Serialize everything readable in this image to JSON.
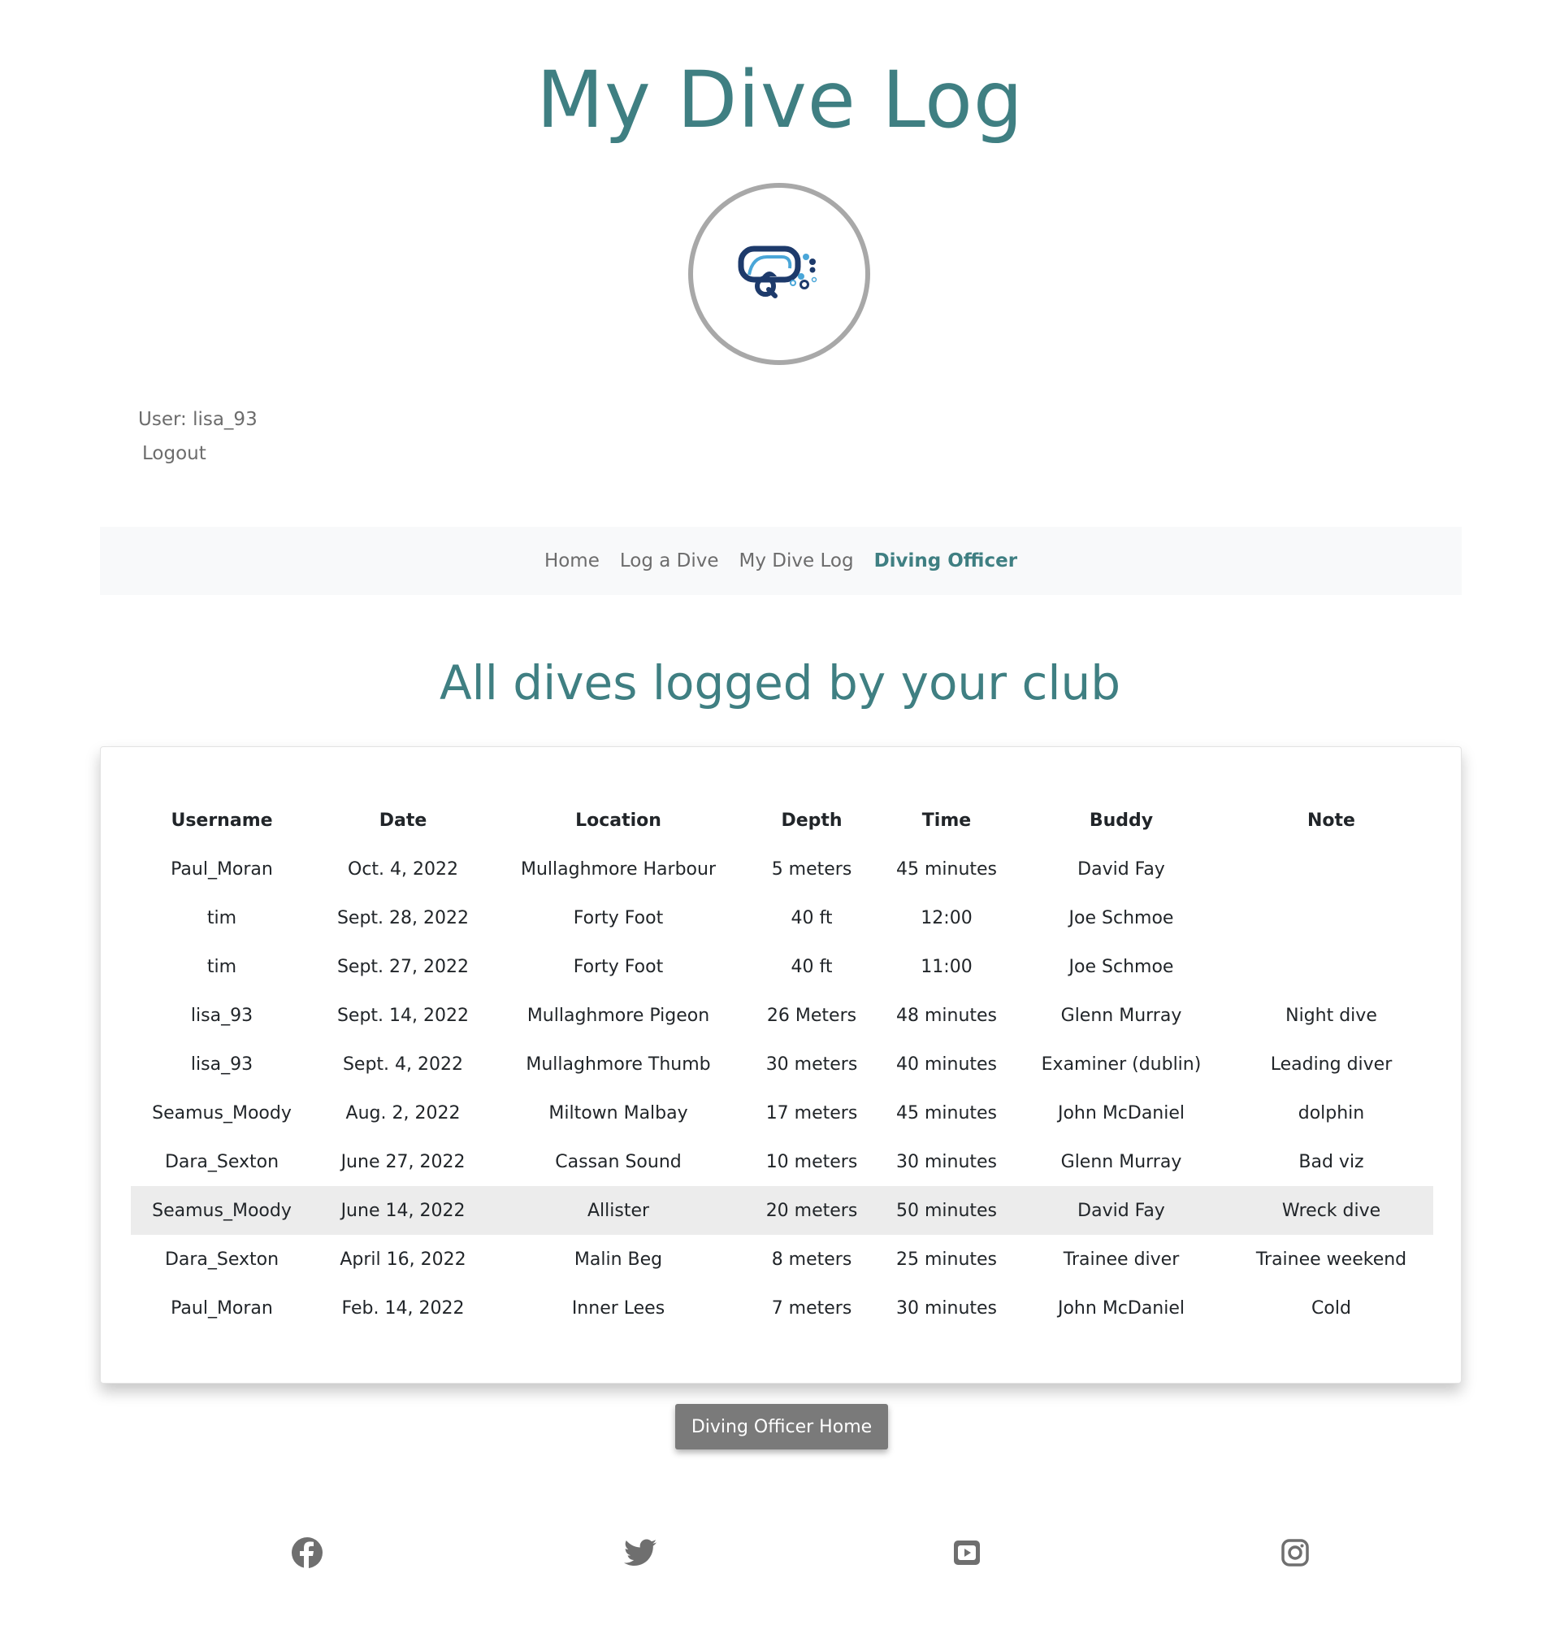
{
  "site": {
    "title": "My Dive Log",
    "logo_icon": "diving-mask-icon"
  },
  "user": {
    "label": "User: lisa_93",
    "logout_label": "Logout"
  },
  "nav": {
    "items": [
      {
        "label": "Home",
        "active": false
      },
      {
        "label": "Log a Dive",
        "active": false
      },
      {
        "label": "My Dive Log",
        "active": false
      },
      {
        "label": "Diving Officer",
        "active": true
      }
    ]
  },
  "main": {
    "heading": "All dives logged by your club",
    "table": {
      "columns": [
        "Username",
        "Date",
        "Location",
        "Depth",
        "Time",
        "Buddy",
        "Note"
      ],
      "rows": [
        [
          "Paul_Moran",
          "Oct. 4, 2022",
          "Mullaghmore Harbour",
          "5 meters",
          "45 minutes",
          "David Fay",
          ""
        ],
        [
          "tim",
          "Sept. 28, 2022",
          "Forty Foot",
          "40 ft",
          "12:00",
          "Joe Schmoe",
          ""
        ],
        [
          "tim",
          "Sept. 27, 2022",
          "Forty Foot",
          "40 ft",
          "11:00",
          "Joe Schmoe",
          ""
        ],
        [
          "lisa_93",
          "Sept. 14, 2022",
          "Mullaghmore Pigeon",
          "26 Meters",
          "48 minutes",
          "Glenn Murray",
          "Night dive"
        ],
        [
          "lisa_93",
          "Sept. 4, 2022",
          "Mullaghmore Thumb",
          "30 meters",
          "40 minutes",
          "Examiner (dublin)",
          "Leading diver"
        ],
        [
          "Seamus_Moody",
          "Aug. 2, 2022",
          "Miltown Malbay",
          "17 meters",
          "45 minutes",
          "John McDaniel",
          "dolphin"
        ],
        [
          "Dara_Sexton",
          "June 27, 2022",
          "Cassan Sound",
          "10 meters",
          "30 minutes",
          "Glenn Murray",
          "Bad viz"
        ],
        [
          "Seamus_Moody",
          "June 14, 2022",
          "Allister",
          "20 meters",
          "50 minutes",
          "David Fay",
          "Wreck dive"
        ],
        [
          "Dara_Sexton",
          "April 16, 2022",
          "Malin Beg",
          "8 meters",
          "25 minutes",
          "Trainee diver",
          "Trainee weekend"
        ],
        [
          "Paul_Moran",
          "Feb. 14, 2022",
          "Inner Lees",
          "7 meters",
          "30 minutes",
          "John McDaniel",
          "Cold"
        ]
      ]
    },
    "button_label": "Diving Officer Home"
  },
  "footer": {
    "social_icons": [
      "facebook-icon",
      "twitter-icon",
      "youtube-icon",
      "instagram-icon"
    ]
  },
  "colors": {
    "brand": "#3f7f82",
    "nav_bg": "#f8f9fa",
    "button_bg": "#7a7a7a",
    "muted_text": "#6c6c6c",
    "highlight_row": "#ececec",
    "icon_gray": "#6f6f6f",
    "logo_dark": "#1d3a6b",
    "logo_light": "#4aa6d8"
  }
}
